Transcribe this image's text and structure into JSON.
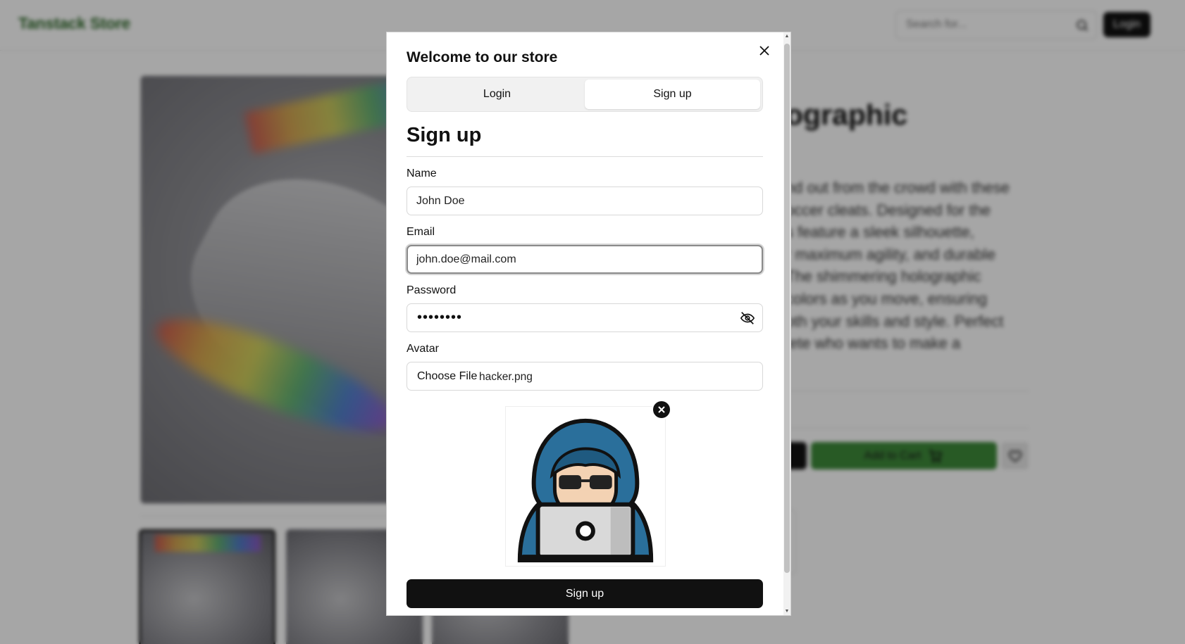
{
  "header": {
    "brand": "Tanstack Store",
    "search_placeholder": "Search for...",
    "login_label": "Login"
  },
  "product": {
    "title_fragment": "ographic",
    "description_lines": [
      "nd out from the crowd with these",
      "occer cleats. Designed for the",
      "s feature a sleek silhouette,",
      "r maximum agility, and durable",
      "The shimmering holographic",
      "colors as you move, ensuring",
      "oth your skills and style. Perfect",
      "lete who wants to make a"
    ],
    "add_to_cart_label": "Add to Cart"
  },
  "modal": {
    "title": "Welcome to our store",
    "tabs": [
      {
        "label": "Login",
        "active": false
      },
      {
        "label": "Sign up",
        "active": true
      }
    ],
    "form_heading": "Sign up",
    "fields": {
      "name": {
        "label": "Name",
        "value": "John Doe"
      },
      "email": {
        "label": "Email",
        "value": "john.doe@mail.com"
      },
      "password": {
        "label": "Password",
        "masked": "••••••••"
      },
      "avatar": {
        "label": "Avatar",
        "button": "Choose File",
        "file_name": "hacker.png"
      }
    },
    "submit_label": "Sign up"
  },
  "colors": {
    "brand": "#2f6b2a",
    "cart_button": "#3e8a3a",
    "primary_dark": "#111111"
  },
  "icons": [
    "search-icon",
    "close-icon",
    "eye-off-icon",
    "cart-icon",
    "heart-icon"
  ]
}
